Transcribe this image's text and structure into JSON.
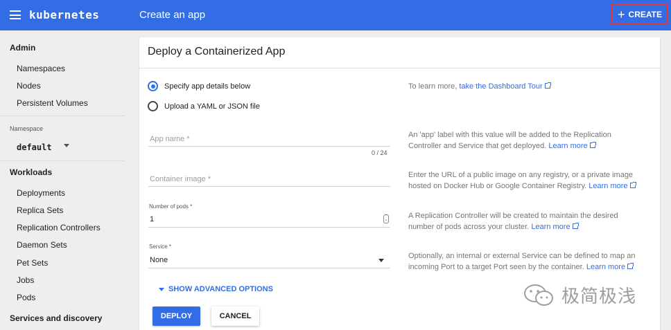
{
  "header": {
    "brand": "kubernetes",
    "title": "Create an app",
    "create_label": "CREATE"
  },
  "sidebar": {
    "admin_header": "Admin",
    "admin_items": [
      "Namespaces",
      "Nodes",
      "Persistent Volumes"
    ],
    "namespace_label": "Namespace",
    "namespace_value": "default",
    "workloads_header": "Workloads",
    "workload_items": [
      "Deployments",
      "Replica Sets",
      "Replication Controllers",
      "Daemon Sets",
      "Pet Sets",
      "Jobs",
      "Pods"
    ],
    "services_header": "Services and discovery"
  },
  "card": {
    "title": "Deploy a Containerized App",
    "radio_specify": "Specify app details below",
    "radio_upload": "Upload a YAML or JSON file",
    "app_name_label": "App name *",
    "app_name_counter": "0 / 24",
    "container_image_label": "Container image *",
    "pods_label": "Number of pods *",
    "pods_value": "1",
    "service_label": "Service *",
    "service_value": "None",
    "advanced_label": "SHOW ADVANCED OPTIONS",
    "deploy_label": "DEPLOY",
    "cancel_label": "CANCEL"
  },
  "help": {
    "tour_text": "To learn more,",
    "tour_link": "take the Dashboard Tour",
    "app_name_text": "An 'app' label with this value will be added to the Replication Controller and Service that get deployed.",
    "container_text": "Enter the URL of a public image on any registry, or a private image hosted on Docker Hub or Google Container Registry.",
    "pods_text": "A Replication Controller will be created to maintain the desired number of pods across your cluster.",
    "service_text": "Optionally, an internal or external Service can be defined to map an incoming Port to a target Port seen by the container.",
    "learn_more": "Learn more"
  },
  "watermark": {
    "text": "极简极浅"
  },
  "colors": {
    "accent": "#326de6",
    "highlight_border": "#e53935"
  }
}
